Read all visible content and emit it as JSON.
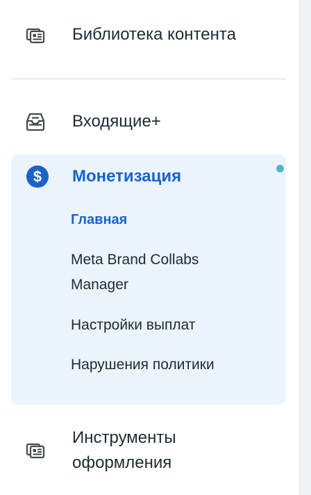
{
  "nav": {
    "content_library": {
      "label": "Библиотека контента",
      "icon": "content-library-icon"
    },
    "inbox": {
      "label": "Входящие+",
      "icon": "inbox-icon"
    },
    "monetization": {
      "label": "Монетизация",
      "icon": "dollar-icon",
      "accent_color": "#1b62c9",
      "has_notification_dot": true,
      "sub_items": [
        {
          "label": "Главная",
          "active": true
        },
        {
          "label_line1": "Meta Brand Collabs",
          "label_line2": "Manager",
          "active": false
        },
        {
          "label": "Настройки выплат",
          "active": false
        },
        {
          "label": "Нарушения политики",
          "active": false
        }
      ]
    },
    "design_tools": {
      "label_line1": "Инструменты",
      "label_line2": "оформления",
      "icon": "design-tools-icon"
    }
  }
}
